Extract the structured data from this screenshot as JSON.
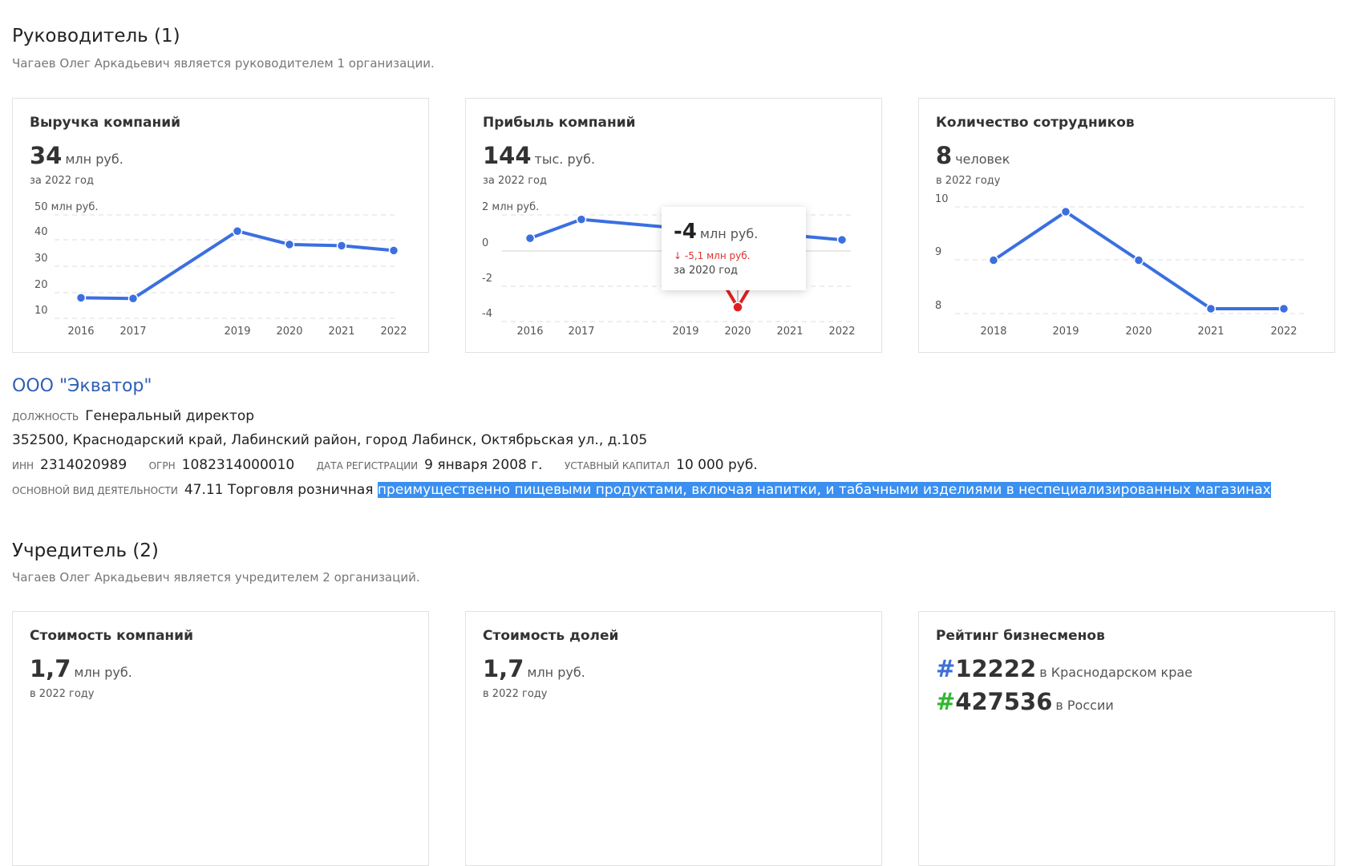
{
  "director_section": {
    "title": "Руководитель (1)",
    "subtitle": "Чагаев Олег Аркадьевич является руководителем 1 организации."
  },
  "cards_top": [
    {
      "title": "Выручка компаний",
      "value": "34",
      "unit": "млн руб.",
      "period": "за 2022 год"
    },
    {
      "title": "Прибыль компаний",
      "value": "144",
      "unit": "тыс. руб.",
      "period": "за 2022 год"
    },
    {
      "title": "Количество сотрудников",
      "value": "8",
      "unit": "человек",
      "period": "в 2022 году"
    }
  ],
  "tooltip": {
    "value": "-4",
    "unit": "млн руб.",
    "delta": "↓ -5,1 млн руб.",
    "period": "за 2020 год"
  },
  "chart_data": [
    {
      "type": "line",
      "title": "Выручка компаний",
      "ylabel": "млн руб.",
      "x": [
        "2016",
        "2017",
        "2019",
        "2020",
        "2021",
        "2022"
      ],
      "series": [
        {
          "values": [
            14.5,
            14.2,
            42,
            36.5,
            36,
            34
          ]
        }
      ],
      "ylim": [
        8,
        52
      ],
      "yticks": [
        "50 млн руб.",
        "40",
        "30",
        "20",
        "10"
      ],
      "grid": true,
      "color": "#3b6fe0"
    },
    {
      "type": "line",
      "title": "Прибыль компаний",
      "ylabel": "млн руб.",
      "x": [
        "2016",
        "2017",
        "2019",
        "2020",
        "2021",
        "2022"
      ],
      "series": [
        {
          "values": [
            0.4,
            1.6,
            1.0,
            -4,
            0.6,
            0.3
          ]
        }
      ],
      "ylim": [
        -4.4,
        2.4
      ],
      "yticks": [
        "2 млн руб.",
        "0",
        "-2",
        "-4"
      ],
      "grid": true,
      "color": "#3b6fe0",
      "highlight": {
        "x": "2020",
        "color": "#e02020"
      }
    },
    {
      "type": "line",
      "title": "Количество сотрудников",
      "x": [
        "2018",
        "2019",
        "2020",
        "2021",
        "2022"
      ],
      "series": [
        {
          "values": [
            9,
            10,
            9,
            8,
            8
          ]
        }
      ],
      "ylim": [
        7.9,
        10.1
      ],
      "yticks": [
        "10",
        "9",
        "8"
      ],
      "grid": true,
      "color": "#3b6fe0"
    }
  ],
  "org": {
    "name": "ООО \"Экватор\"",
    "position_label": "должность",
    "position": "Генеральный директор",
    "address": "352500, Краснодарский край, Лабинский район, город Лабинск, Октябрьская ул., д.105",
    "inn_label": "ИНН",
    "inn": "2314020989",
    "ogrn_label": "ОГРН",
    "ogrn": "1082314000010",
    "reg_label": "дата регистрации",
    "reg_date": "9 января 2008 г.",
    "capital_label": "уставный капитал",
    "capital": "10 000 руб.",
    "activity_label": "основной вид деятельности",
    "activity_start": "47.11 Торговля розничная",
    "activity_selected": "преимущественно пищевыми продуктами, включая напитки, и табачными изделиями в неспециализированных магазинах"
  },
  "founder_section": {
    "title": "Учредитель (2)",
    "subtitle": "Чагаев Олег Аркадьевич является учредителем 2 организаций."
  },
  "cards_bottom": [
    {
      "title": "Стоимость компаний",
      "value": "1,7",
      "unit": "млн руб.",
      "period": "в 2022 году"
    },
    {
      "title": "Стоимость долей",
      "value": "1,7",
      "unit": "млн руб.",
      "period": "в 2022 году"
    },
    {
      "title": "Рейтинг бизнесменов",
      "rank1_hash": "#",
      "rank1": "12222",
      "rank1_region": "в Краснодарском крае",
      "rank2_hash": "#",
      "rank2": "427536",
      "rank2_region": "в России"
    }
  ],
  "colors": {
    "accent": "#3b6fe0",
    "link": "#2f5fb3",
    "negative": "#e02020",
    "selection": "#3a8ff0"
  }
}
